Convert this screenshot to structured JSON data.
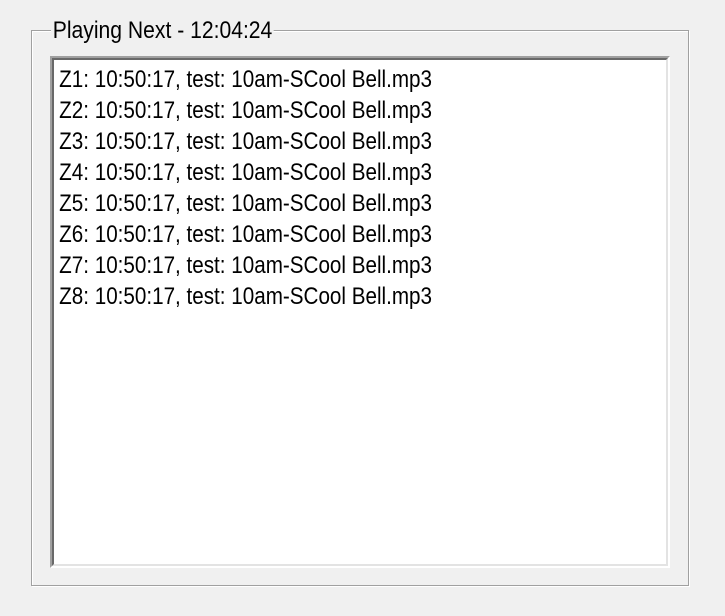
{
  "group": {
    "title": "Playing Next - 12:04:24"
  },
  "playlist": {
    "items": [
      "Z1: 10:50:17, test: 10am-SCool Bell.mp3",
      "Z2: 10:50:17, test: 10am-SCool Bell.mp3",
      "Z3: 10:50:17, test: 10am-SCool Bell.mp3",
      "Z4: 10:50:17, test: 10am-SCool Bell.mp3",
      "Z5: 10:50:17, test: 10am-SCool Bell.mp3",
      "Z6: 10:50:17, test: 10am-SCool Bell.mp3",
      "Z7: 10:50:17, test: 10am-SCool Bell.mp3",
      "Z8: 10:50:17, test: 10am-SCool Bell.mp3"
    ]
  }
}
